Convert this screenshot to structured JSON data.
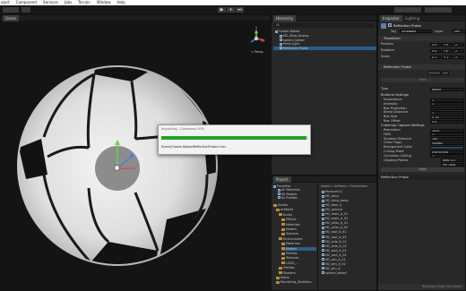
{
  "menu": [
    "oject",
    "Component",
    "Services",
    "Jobs",
    "Terrain",
    "Window",
    "Help"
  ],
  "toolbar": {
    "play": "▶",
    "pause": "⏸",
    "step": "⏭"
  },
  "game_view": {
    "tab": "Game",
    "scene_label": "< Persp",
    "gizmo_axes": {
      "y": "y",
      "x": "x",
      "z": "z"
    }
  },
  "hierarchy": {
    "tab": "Hierarchy",
    "search_placeholder": "All",
    "items": [
      "Cookie Baked",
      "M2_diing_toseng",
      "sphere_baked",
      "Point Light",
      "Reflection Probe"
    ]
  },
  "inspector": {
    "tabs": [
      "Inspector",
      "Lighting"
    ],
    "object_name": "Reflection Probe",
    "tag_label": "Tag",
    "tag_value": "Untagged",
    "layer_label": "Layer",
    "layer_value": "Def",
    "transform": {
      "title": "Transform",
      "rows": [
        {
          "label": "Position",
          "x": "X 0",
          "y": "Y 0",
          "z": "Z"
        },
        {
          "label": "Rotation",
          "x": "X 0",
          "y": "Y 0",
          "z": "Z"
        },
        {
          "label": "Scale",
          "x": "X 1",
          "y": "Y 1",
          "z": "Z"
        }
      ]
    },
    "reflection_probe": {
      "title": "Reflection Probe",
      "bake_button": "Bake",
      "type_label": "Type",
      "type_value": "Baked",
      "runtime_title": "Runtime Settings",
      "runtime_rows": [
        {
          "label": "Importance",
          "value": "1"
        },
        {
          "label": "Intensity",
          "value": "1"
        },
        {
          "label": "Box Projection",
          "value": ""
        },
        {
          "label": "Blend Distance",
          "value": "1"
        },
        {
          "label": "Box Size",
          "value": "X 10"
        },
        {
          "label": "Box Offset",
          "value": "X 0"
        }
      ],
      "cubemap_title": "Cubemap Capture Settings",
      "cubemap_rows": [
        {
          "label": "Resolution",
          "value": "1024"
        },
        {
          "label": "HDR",
          "value": "✓"
        },
        {
          "label": "Shadow Distance",
          "value": "100"
        },
        {
          "label": "Clear Flags",
          "value": "Skybox"
        },
        {
          "label": "Background Color",
          "value": ""
        },
        {
          "label": "Culling Mask",
          "value": "Everything"
        },
        {
          "label": "Occlusion Culling",
          "value": "✓"
        },
        {
          "label": "Clipping Planes",
          "near": "Near  0.3",
          "far": "Far   1000"
        }
      ],
      "footer": "Reflection Probe"
    },
    "status": "Reflection Probe (Ver baked.."
  },
  "project": {
    "tab": "Project",
    "favorites": [
      "Favorites",
      "All Materials",
      "All Models",
      "All Prefabs"
    ],
    "tree": [
      "Assets",
      "Artifacts",
      "Audio",
      "Effects",
      "Materials",
      "Models",
      "Textures",
      "Environment",
      "Materials",
      "Models",
      "Prefabs",
      "Textures",
      "LODG_...",
      "Prefabs",
      "Shaders",
      "Editor",
      "Rendering_Statistics"
    ],
    "breadcrumb": "Assets > Artifacts > Environmen",
    "files": [
      "Museum(1)",
      "M2_dirrg",
      "M2_dirrg_iseng",
      "M2_door_A",
      "M2_ground",
      "M2_main_A_01",
      "M2_main_A_02",
      "M2_pillar_A_01",
      "M2_pillar_A_02",
      "M2_roof_A_01",
      "M2_roof_A_02",
      "M2_side_A_01",
      "M2_side_A_02",
      "M2_wall_A_01",
      "M2_wall_A_02",
      "M2_win_A_01",
      "M2_win_A_02",
      "M2_win_A",
      "sphere_baked"
    ]
  },
  "dialog": {
    "title": "Importing - Compress 50%",
    "progress": 0.99,
    "path": "Scene/Cookie Baked/ReflectionProbe-0.exr"
  },
  "colors": {
    "accent": "#1fa22a",
    "selection": "#2c5d87",
    "panel": "#282828"
  }
}
